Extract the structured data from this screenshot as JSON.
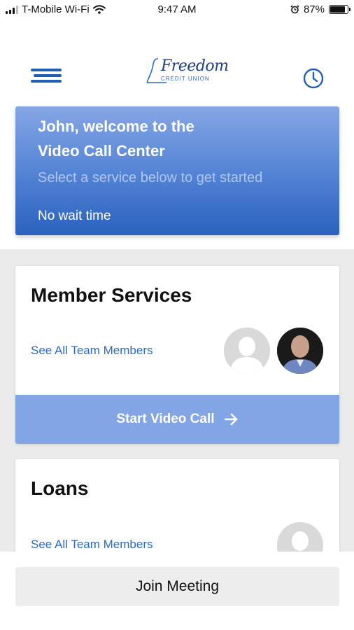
{
  "status_bar": {
    "carrier": "T-Mobile Wi-Fi",
    "time": "9:47 AM",
    "battery": "87%",
    "battery_level": 0.87
  },
  "header": {
    "logo_name": "Freedom",
    "logo_sub": "CREDIT UNION",
    "menu_icon": "hamburger-menu-icon",
    "history_icon": "clock-icon"
  },
  "welcome": {
    "line1": "John, welcome to the",
    "line2": "Video Call Center",
    "subtitle": "Select a service below to get started",
    "wait": "No wait time"
  },
  "services": [
    {
      "title": "Member Services",
      "link": "See All Team Members",
      "cta": "Start Video Call"
    },
    {
      "title": "Loans",
      "link": "See All Team Members"
    }
  ],
  "bottom": {
    "join_label": "Join Meeting"
  },
  "colors": {
    "accent": "#2a6bc2",
    "banner_top": "#85a6e4",
    "banner_bottom": "#2a62be",
    "cta": "#82a5e6"
  }
}
